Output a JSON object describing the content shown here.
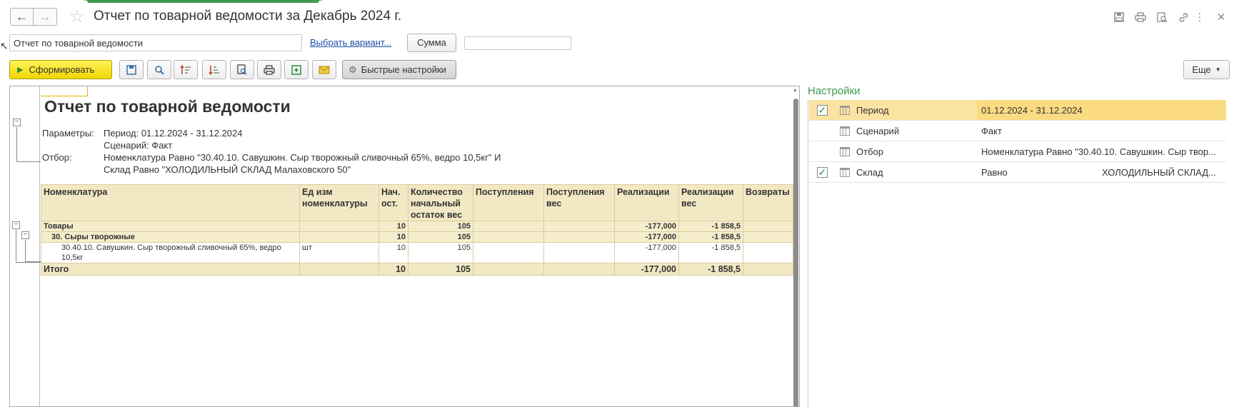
{
  "window": {
    "title": "Отчет по товарной ведомости за Декабрь 2024 г."
  },
  "header_icons": [
    "save-icon",
    "print-icon",
    "preview-icon",
    "link-icon",
    "more-vertical-icon",
    "close-icon"
  ],
  "variant": {
    "current": "Отчет по товарной ведомости",
    "choose_link": "Выбрать вариант...",
    "sum_label": "Сумма",
    "sum_value": ""
  },
  "toolbar": {
    "generate": "Сформировать",
    "quick_settings": "Быстрые настройки",
    "more": "Еще"
  },
  "report": {
    "title": "Отчет по товарной ведомости",
    "params_label": "Параметры:",
    "param_period": "Период: 01.12.2024 - 31.12.2024",
    "param_scenario": "Сценарий: Факт",
    "filter_label": "Отбор:",
    "filter_line1": "Номенклатура Равно \"30.40.10. Савушкин. Сыр творожный сливочный 65%, ведро 10,5кг\" И",
    "filter_line2": "Склад Равно \"ХОЛОДИЛЬНЫЙ СКЛАД Малаховского 50\"",
    "columns": [
      "Номенклатура",
      "Ед изм номенклатуры",
      "Нач. ост.",
      "Количество начальный остаток вес",
      "Поступления",
      "Поступления вес",
      "Реализации",
      "Реализации вес",
      "Возвраты"
    ],
    "rows": [
      {
        "kind": "grp",
        "cells": [
          "Товары",
          "",
          "10",
          "105",
          "",
          "",
          "-177,000",
          "-1 858,5",
          ""
        ]
      },
      {
        "kind": "grp",
        "cells": [
          "30. Сыры творожные",
          "",
          "10",
          "105",
          "",
          "",
          "-177,000",
          "-1 858,5",
          ""
        ]
      },
      {
        "kind": "item",
        "cells": [
          "30.40.10. Савушкин. Сыр творожный сливочный 65%, ведро 10,5кг",
          "шт",
          "10",
          "105",
          "",
          "",
          "-177,000",
          "-1 858,5",
          ""
        ]
      },
      {
        "kind": "total",
        "cells": [
          "Итого",
          "",
          "10",
          "105",
          "",
          "",
          "-177,000",
          "-1 858,5",
          ""
        ]
      }
    ]
  },
  "settings": {
    "title": "Настройки",
    "rows": [
      {
        "name": "Период",
        "checked": true,
        "value": "01.12.2024 - 31.12.2024",
        "value2": ""
      },
      {
        "name": "Сценарий",
        "checked": false,
        "value": "Факт",
        "value2": ""
      },
      {
        "name": "Отбор",
        "checked": false,
        "value": "Номенклатура Равно \"30.40.10. Савушкин. Сыр твор...",
        "value2": ""
      },
      {
        "name": "Склад",
        "checked": true,
        "value": "Равно",
        "value2": "ХОЛОДИЛЬНЫЙ СКЛАД..."
      }
    ]
  },
  "colors": {
    "accent_green": "#3f9a4e",
    "generate_yellow": "#f1d600",
    "table_header": "#f2e9c4",
    "selected_row": "#fbe3a3"
  }
}
